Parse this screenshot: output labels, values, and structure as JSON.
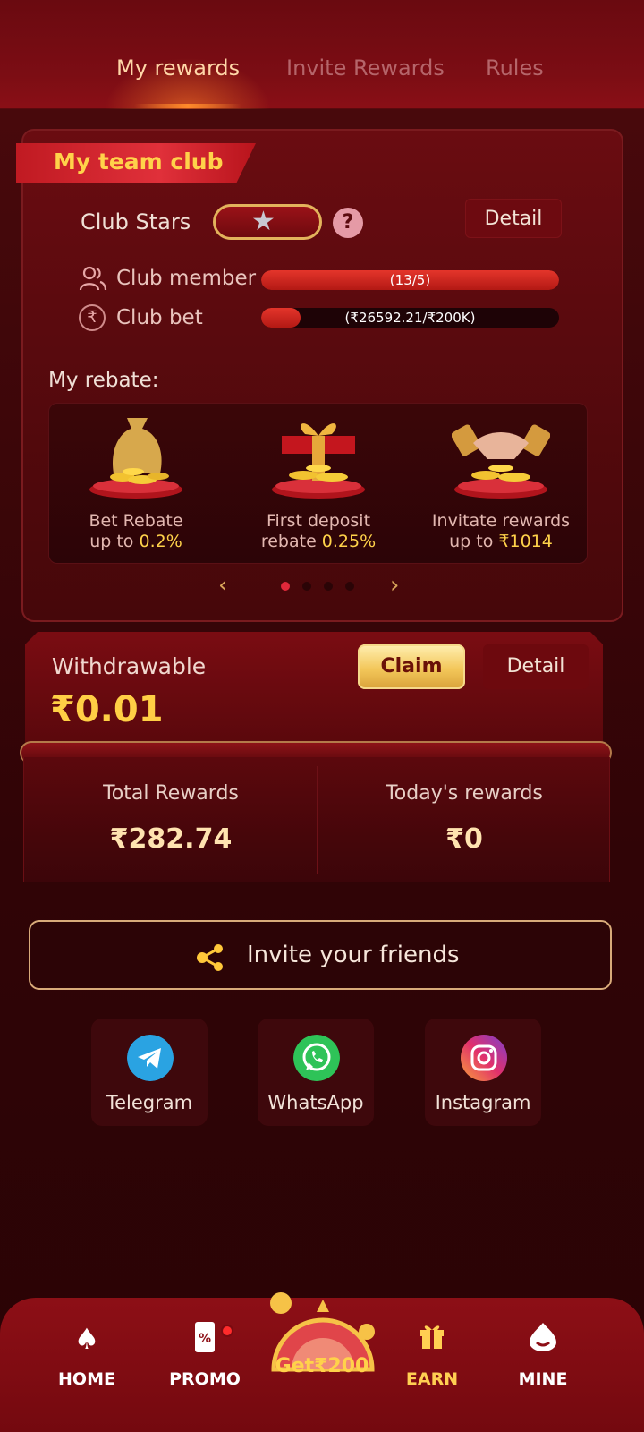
{
  "tabs": [
    {
      "label": "My rewards",
      "active": true
    },
    {
      "label": "Invite Rewards",
      "active": false
    },
    {
      "label": "Rules",
      "active": false
    }
  ],
  "club": {
    "title": "My team club",
    "stars_label": "Club Stars",
    "detail_label": "Detail",
    "member_label": "Club member",
    "member_progress_text": "(13/5)",
    "member_progress": 1.0,
    "bet_label": "Club bet",
    "bet_progress_text": "(₹26592.21/₹200K)",
    "bet_progress": 0.133,
    "rebate_title": "My rebate:",
    "rebates": [
      {
        "line1": "Bet Rebate",
        "line2_prefix": "up to ",
        "line2_value": "0.2%"
      },
      {
        "line1": "First deposit",
        "line2_prefix": "rebate ",
        "line2_value": "0.25%"
      },
      {
        "line1": "Invitate rewards",
        "line2_prefix": "up to ",
        "line2_value": "₹1014"
      }
    ],
    "pager_total": 4,
    "pager_active": 0
  },
  "withdrawable": {
    "label": "Withdrawable",
    "amount": "₹0.01",
    "claim_label": "Claim",
    "detail_label": "Detail"
  },
  "totals": {
    "total_label": "Total Rewards",
    "total_value": "₹282.74",
    "today_label": "Today's rewards",
    "today_value": "₹0"
  },
  "invite": {
    "label": "Invite your friends"
  },
  "social": [
    {
      "label": "Telegram"
    },
    {
      "label": "WhatsApp"
    },
    {
      "label": "Instagram"
    }
  ],
  "nav": {
    "home": "HOME",
    "promo": "PROMO",
    "get": "Get₹200",
    "earn": "EARN",
    "mine": "MINE"
  },
  "colors": {
    "accent_gold": "#ffd24a",
    "bg_dark_red": "#3d0609",
    "ribbon_red": "#e0303a"
  }
}
